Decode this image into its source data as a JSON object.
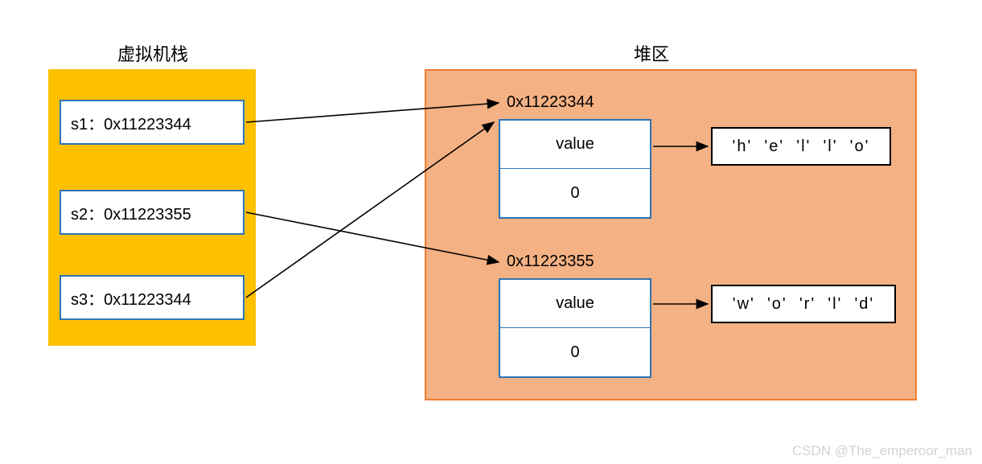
{
  "titles": {
    "stack": "虚拟机栈",
    "heap": "堆区"
  },
  "stack": {
    "s1": "s1：0x11223344",
    "s2": "s2：0x11223355",
    "s3": "s3：0x11223344"
  },
  "heap": {
    "addr1": "0x11223344",
    "addr2": "0x11223355",
    "obj1": {
      "field": "value",
      "offset": "0"
    },
    "obj2": {
      "field": "value",
      "offset": "0"
    }
  },
  "chars": {
    "arr1": "'h'  'e'  'l'  'l'  'o'",
    "arr2": "'w'  'o'  'r'  'l'  'd'"
  },
  "watermark": "CSDN @The_emperoor_man",
  "chart_data": {
    "type": "table",
    "title": "Java String references: stack → heap → char array",
    "stack_frames": [
      {
        "var": "s1",
        "ref": "0x11223344"
      },
      {
        "var": "s2",
        "ref": "0x11223355"
      },
      {
        "var": "s3",
        "ref": "0x11223344"
      }
    ],
    "heap_objects": [
      {
        "address": "0x11223344",
        "value_field_points_to": [
          "h",
          "e",
          "l",
          "l",
          "o"
        ],
        "offset": 0
      },
      {
        "address": "0x11223355",
        "value_field_points_to": [
          "w",
          "o",
          "r",
          "l",
          "d"
        ],
        "offset": 0
      }
    ],
    "pointer_edges": [
      [
        "s1",
        "0x11223344"
      ],
      [
        "s3",
        "0x11223344"
      ],
      [
        "s2",
        "0x11223355"
      ],
      [
        "0x11223344.value",
        "hello_chars"
      ],
      [
        "0x11223355.value",
        "world_chars"
      ]
    ]
  }
}
